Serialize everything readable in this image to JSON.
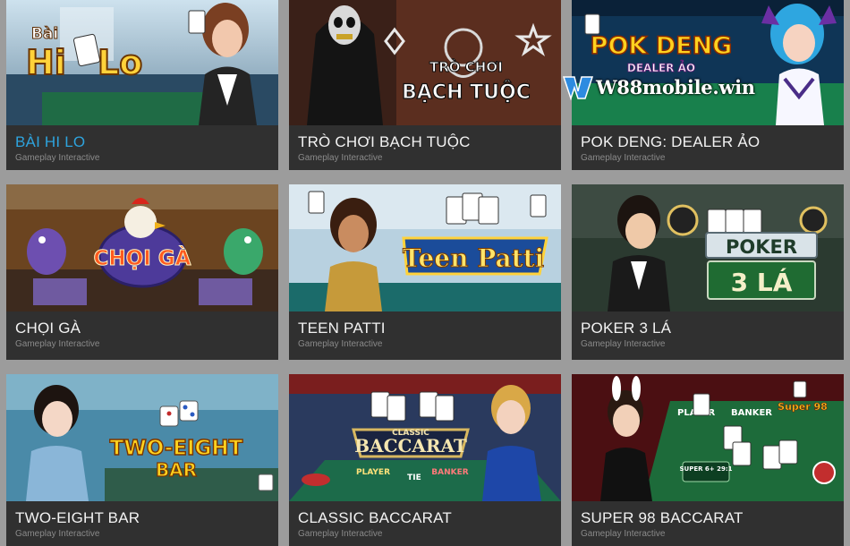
{
  "provider_label": "Gameplay Interactive",
  "watermark": {
    "text": "W88mobile.win"
  },
  "colors": {
    "background": "#9c9c9c",
    "card": "#303030",
    "active_title": "#2ea3dd"
  },
  "games": [
    {
      "title": "BÀI HI LO",
      "provider": "Gameplay Interactive",
      "art_text": [
        "Bài",
        "Hi",
        "Lo"
      ],
      "active": true
    },
    {
      "title": "TRÒ CHƠI BẠCH TUỘC",
      "provider": "Gameplay Interactive",
      "art_text": [
        "TRÒ CHƠI",
        "BẠCH TUỘC"
      ]
    },
    {
      "title": "POK DENG: DEALER ẢO",
      "provider": "Gameplay Interactive",
      "art_text": [
        "POK DENG",
        "DEALER ẢO"
      ]
    },
    {
      "title": "CHỌI GÀ",
      "provider": "Gameplay Interactive",
      "art_text": [
        "CHỌI GÀ"
      ]
    },
    {
      "title": "TEEN PATTI",
      "provider": "Gameplay Interactive",
      "art_text": [
        "Teen Patti"
      ]
    },
    {
      "title": "POKER 3 LÁ",
      "provider": "Gameplay Interactive",
      "art_text": [
        "POKER",
        "3 LÁ"
      ]
    },
    {
      "title": "TWO-EIGHT BAR",
      "provider": "Gameplay Interactive",
      "art_text": [
        "TWO-EIGHT",
        "BAR"
      ]
    },
    {
      "title": "CLASSIC BACCARAT",
      "provider": "Gameplay Interactive",
      "art_text": [
        "CLASSIC",
        "BACCARAT",
        "PLAYER",
        "TIE",
        "BANKER"
      ]
    },
    {
      "title": "SUPER 98 BACCARAT",
      "provider": "Gameplay Interactive",
      "art_text": [
        "PLAYER",
        "BANKER",
        "Super 98",
        "SUPER 6+ 29:1"
      ]
    }
  ]
}
